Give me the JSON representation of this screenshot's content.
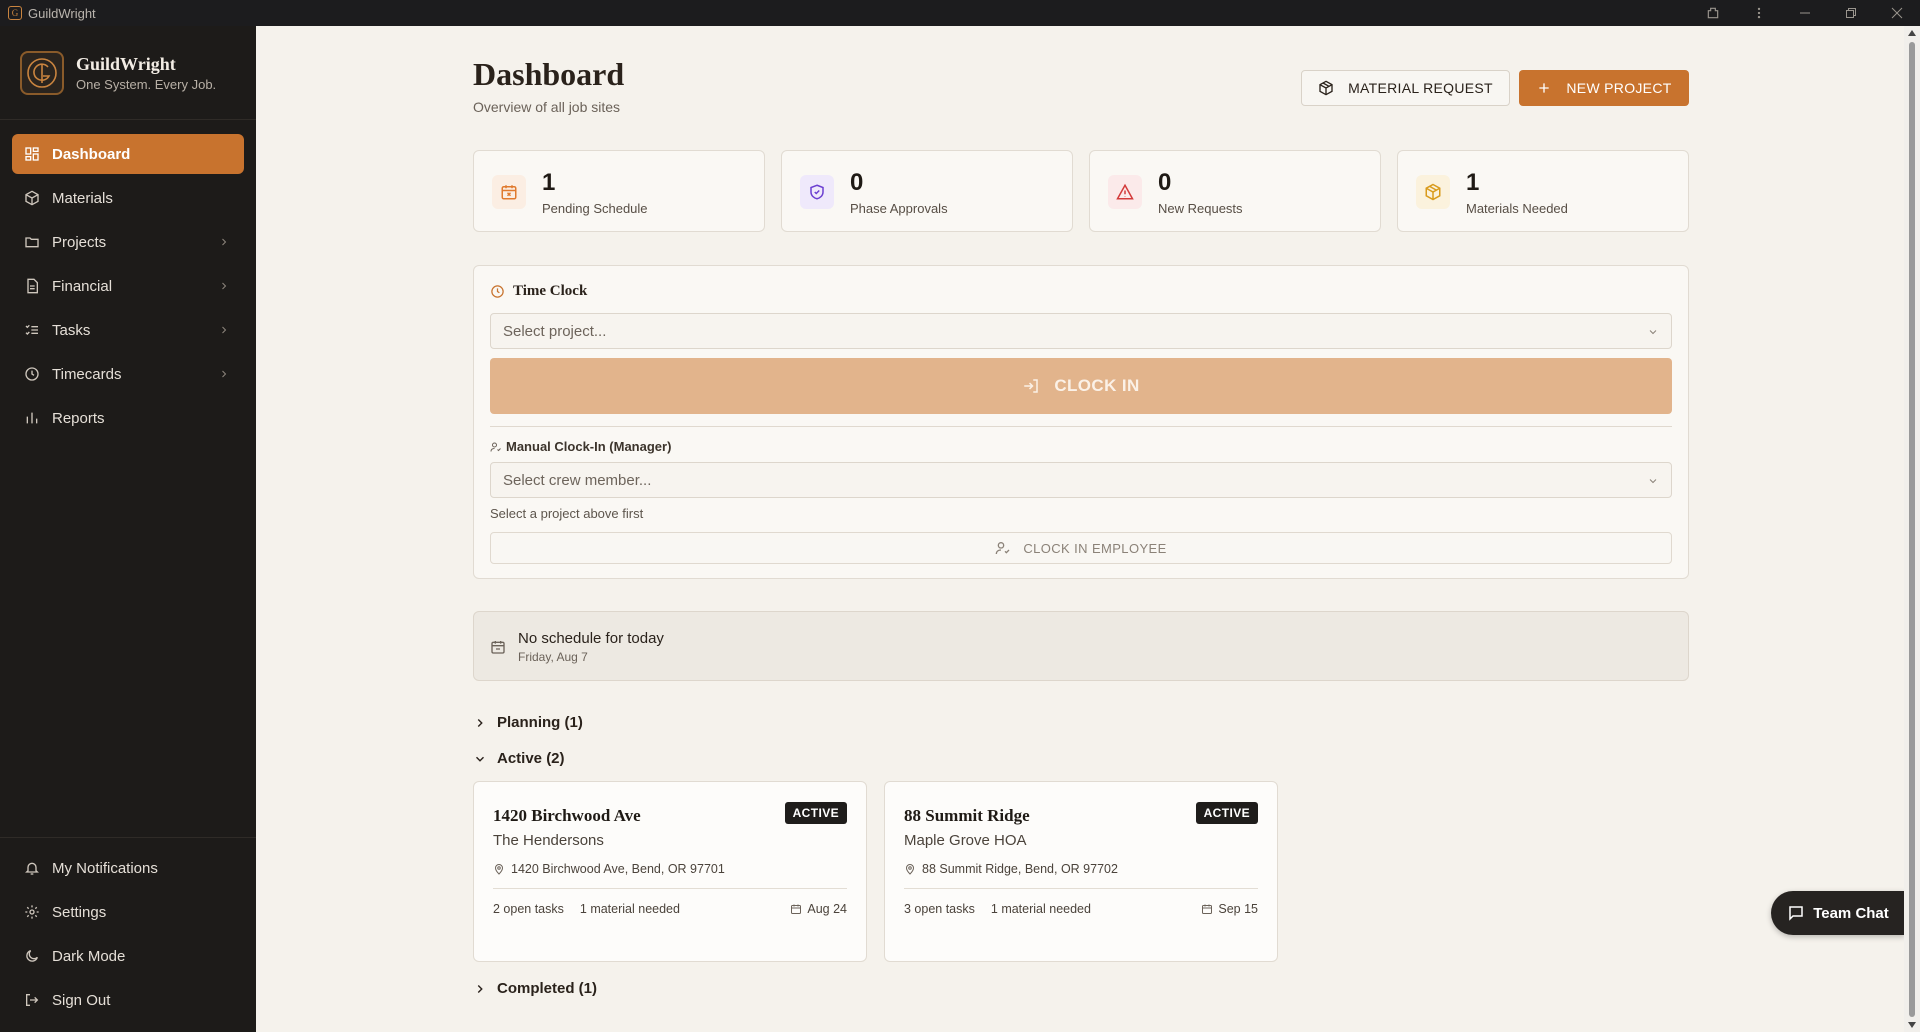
{
  "window": {
    "title": "GuildWright"
  },
  "brand": {
    "name": "GuildWright",
    "tagline": "One System. Every Job."
  },
  "sidebar": {
    "items": [
      {
        "label": "Dashboard",
        "icon": "grid-icon",
        "active": true
      },
      {
        "label": "Materials",
        "icon": "box-icon"
      },
      {
        "label": "Projects",
        "icon": "folder-icon",
        "expandable": true
      },
      {
        "label": "Financial",
        "icon": "document-icon",
        "expandable": true
      },
      {
        "label": "Tasks",
        "icon": "list-checks-icon",
        "expandable": true
      },
      {
        "label": "Timecards",
        "icon": "clock-icon",
        "expandable": true
      },
      {
        "label": "Reports",
        "icon": "bar-chart-icon"
      }
    ],
    "bottom_items": [
      {
        "label": "My Notifications",
        "icon": "bell-icon"
      },
      {
        "label": "Settings",
        "icon": "gear-icon"
      },
      {
        "label": "Dark Mode",
        "icon": "moon-icon"
      },
      {
        "label": "Sign Out",
        "icon": "sign-out-icon"
      }
    ]
  },
  "header": {
    "title": "Dashboard",
    "subtitle": "Overview of all job sites",
    "material_request_label": "MATERIAL REQUEST",
    "new_project_label": "NEW PROJECT"
  },
  "stats": [
    {
      "value": "1",
      "label": "Pending Schedule",
      "icon": "calendar-x-icon",
      "color": "#e07a2e",
      "bg": "#fbeee3"
    },
    {
      "value": "0",
      "label": "Phase Approvals",
      "icon": "shield-check-icon",
      "color": "#6b3fd1",
      "bg": "#efe9fb"
    },
    {
      "value": "0",
      "label": "New Requests",
      "icon": "alert-triangle-icon",
      "color": "#d33a3a",
      "bg": "#fbeaea"
    },
    {
      "value": "1",
      "label": "Materials Needed",
      "icon": "package-icon",
      "color": "#d99b1c",
      "bg": "#fbf2dd"
    }
  ],
  "time_clock": {
    "title": "Time Clock",
    "project_placeholder": "Select project...",
    "clock_in_label": "CLOCK IN",
    "manual_label": "Manual Clock-In (Manager)",
    "crew_placeholder": "Select crew member...",
    "hint": "Select a project above first",
    "clock_in_employee_label": "CLOCK IN EMPLOYEE"
  },
  "schedule": {
    "title": "No schedule for today",
    "date": "Friday, Aug 7"
  },
  "sections": {
    "planning": "Planning (1)",
    "active": "Active (2)",
    "completed": "Completed (1)"
  },
  "projects": [
    {
      "name": "1420 Birchwood Ave",
      "status": "ACTIVE",
      "client": "The Hendersons",
      "address": "1420 Birchwood Ave, Bend, OR 97701",
      "tasks": "2 open tasks",
      "materials": "1 material needed",
      "date": "Aug 24"
    },
    {
      "name": "88 Summit Ridge",
      "status": "ACTIVE",
      "client": "Maple Grove HOA",
      "address": "88 Summit Ridge, Bend, OR 97702",
      "tasks": "3 open tasks",
      "materials": "1 material needed",
      "date": "Sep 15"
    }
  ],
  "team_chat": {
    "label": "Team Chat"
  },
  "colors": {
    "accent": "#c8732e",
    "sidebar_bg": "#1d1b19",
    "page_bg": "#f5f2ec"
  }
}
